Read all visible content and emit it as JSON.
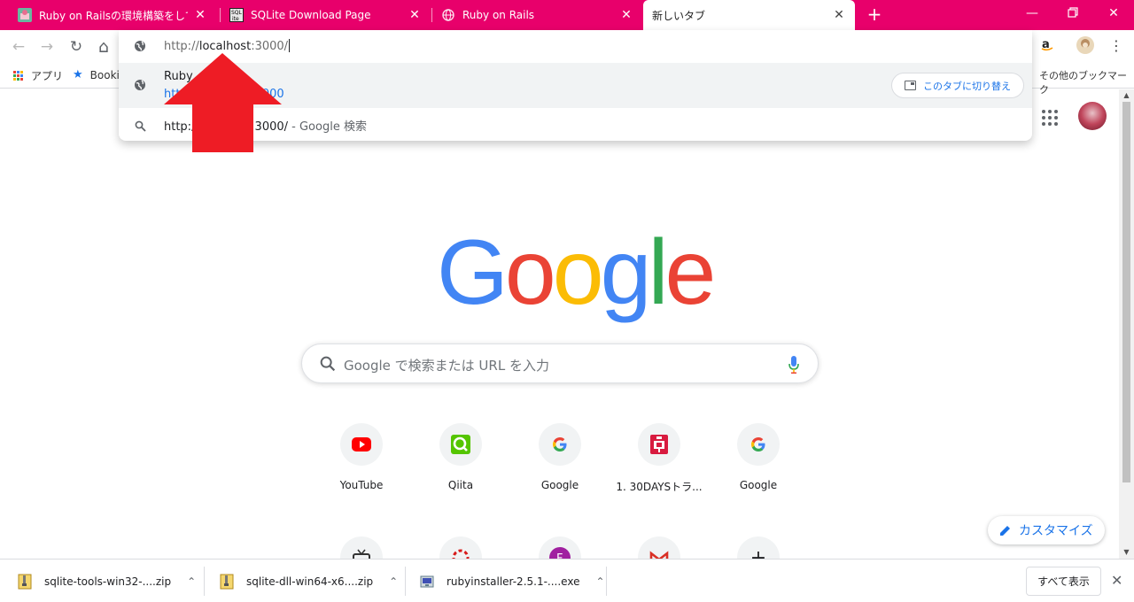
{
  "tabs": [
    {
      "title": "Ruby on Railsの環境構築をしてみよう",
      "favicon": "site-icon"
    },
    {
      "title": "SQLite Download Page",
      "favicon": "sqlite-icon"
    },
    {
      "title": "Ruby on Rails",
      "favicon": "globe-icon"
    },
    {
      "title": "新しいタブ",
      "favicon": "none",
      "active": true
    }
  ],
  "toolbar": {
    "back": "←",
    "forward": "→",
    "reload": "↻",
    "home": "⌂"
  },
  "bookmarks": {
    "apps_label": "アプリ",
    "bookmark_label": "Booki",
    "other_label": "その他のブックマーク"
  },
  "omnibox": {
    "url_prefix": "http://",
    "url_host": "localhost",
    "url_suffix": ":3000/",
    "suggestion_title": "Ruby",
    "suggestion_url": "http://localhost:3000",
    "switch_tab_label": "このタブに切り替え",
    "search_query": "http://localhost:3000/",
    "search_suffix": " - Google 検索"
  },
  "ntp": {
    "logo_letters": [
      "G",
      "o",
      "o",
      "g",
      "l",
      "e"
    ],
    "logo_colors": [
      "#4285F4",
      "#EA4335",
      "#FBBC05",
      "#4285F4",
      "#34A853",
      "#EA4335"
    ],
    "search_placeholder": "Google で検索または URL を入力",
    "shortcuts": [
      {
        "label": "YouTube",
        "icon": "youtube-icon"
      },
      {
        "label": "Qiita",
        "icon": "qiita-icon"
      },
      {
        "label": "Google",
        "icon": "google-icon"
      },
      {
        "label": "1. 30DAYSトラ...",
        "icon": "dotinstall-icon"
      },
      {
        "label": "Google",
        "icon": "google-icon"
      }
    ],
    "customize_label": "カスタマイズ"
  },
  "downloads": [
    {
      "name": "sqlite-tools-win32-....zip"
    },
    {
      "name": "sqlite-dll-win64-x6....zip"
    },
    {
      "name": "rubyinstaller-2.5.1-....exe"
    }
  ],
  "shelf": {
    "show_all": "すべて表示"
  },
  "colors": {
    "tabstrip": "#e8006b",
    "accent": "#1a73e8",
    "arrow": "#ee1c25"
  }
}
